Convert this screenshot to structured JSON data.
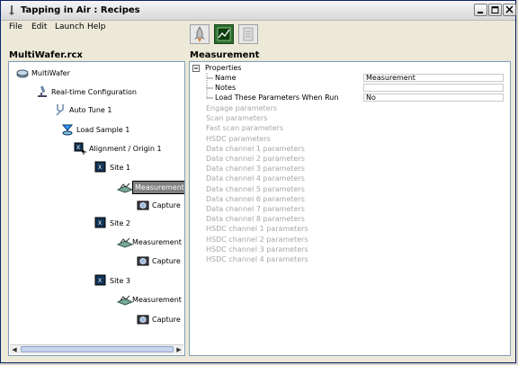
{
  "window": {
    "title": "Tapping in Air : Recipes"
  },
  "menu": [
    "File",
    "Edit",
    "Launch",
    "Help"
  ],
  "toolbar": [
    {
      "icon": "rocket-icon"
    },
    {
      "icon": "scope-graph-icon"
    },
    {
      "icon": "document-icon"
    }
  ],
  "left_pane": {
    "title": "MultiWafer.rcx",
    "tree": [
      {
        "label": "MultiWafer",
        "icon": "wafer-icon"
      },
      {
        "label": "Real-time Configuration",
        "icon": "microscope-icon"
      },
      {
        "label": "Auto Tune 1",
        "icon": "tuning-fork-icon"
      },
      {
        "label": "Load Sample 1",
        "icon": "load-sample-icon"
      },
      {
        "label": "Alignment / Origin 1",
        "icon": "alignment-icon"
      },
      {
        "label": "Site 1",
        "icon": "site-icon"
      },
      {
        "label": "Measurement",
        "icon": "measurement-icon",
        "selected": true
      },
      {
        "label": "Capture",
        "icon": "camera-icon"
      },
      {
        "label": "Site 2",
        "icon": "site-icon"
      },
      {
        "label": "Measurement",
        "icon": "measurement-icon"
      },
      {
        "label": "Capture",
        "icon": "camera-icon"
      },
      {
        "label": "Site 3",
        "icon": "site-icon"
      },
      {
        "label": "Measurement",
        "icon": "measurement-icon"
      },
      {
        "label": "Capture",
        "icon": "camera-icon"
      }
    ]
  },
  "right_pane": {
    "title": "Measurement",
    "properties_header": "Properties",
    "properties": [
      {
        "name": "Name",
        "value": "Measurement"
      },
      {
        "name": "Notes",
        "value": ""
      },
      {
        "name": "Load These Parameters When Run",
        "value": "No"
      }
    ],
    "disabled_groups": [
      "Engage parameters",
      "Scan parameters",
      "Fast scan parameters",
      "HSDC parameters",
      "Data channel 1 parameters",
      "Data channel 2 parameters",
      "Data channel 3 parameters",
      "Data channel 4 parameters",
      "Data channel 5 parameters",
      "Data channel 6 parameters",
      "Data channel 7 parameters",
      "Data channel 8 parameters",
      "HSDC channel 1 parameters",
      "HSDC channel 2 parameters",
      "HSDC channel 3 parameters",
      "HSDC channel 4 parameters"
    ]
  },
  "colors": {
    "disabled_text": "#a8a8a8",
    "selection": "#808080"
  }
}
